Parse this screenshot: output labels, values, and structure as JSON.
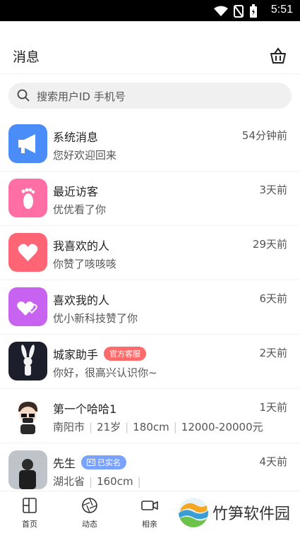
{
  "status_bar": {
    "time": "5:51"
  },
  "header": {
    "title": "消息",
    "basket_icon": "basket-icon"
  },
  "search": {
    "placeholder": "搜索用户ID 手机号"
  },
  "messages": [
    {
      "name": "系统消息",
      "preview": "您好欢迎回来",
      "time": "54分钟前",
      "icon": "megaphone-icon",
      "color": "#4a8df8"
    },
    {
      "name": "最近访客",
      "preview": "优优看了你",
      "time": "3天前",
      "icon": "footprint-icon",
      "color": "#ff6fa5"
    },
    {
      "name": "我喜欢的人",
      "preview": "你赞了咳咳咳",
      "time": "29天前",
      "icon": "heart-icon",
      "color": "#ff6574"
    },
    {
      "name": "喜欢我的人",
      "preview": "优小新科技赞了你",
      "time": "6天前",
      "icon": "hearts-icon",
      "color": "#c763f0"
    },
    {
      "name": "城家助手",
      "badge": "官方客服",
      "preview": "你好，很高兴认识你~",
      "time": "2天前"
    },
    {
      "name": "第一个哈哈1",
      "details": [
        "南阳市",
        "21岁",
        "180cm",
        "12000-20000元"
      ],
      "time": "1天前"
    },
    {
      "name": "先生",
      "badge": "已实名",
      "details": [
        "湖北省",
        "160cm"
      ],
      "time": "4天前"
    }
  ],
  "tabbar": [
    {
      "label": "首页",
      "icon": "home-icon"
    },
    {
      "label": "动态",
      "icon": "aperture-icon"
    },
    {
      "label": "相亲",
      "icon": "video-icon"
    }
  ],
  "watermark": {
    "text": "竹笋软件园"
  }
}
